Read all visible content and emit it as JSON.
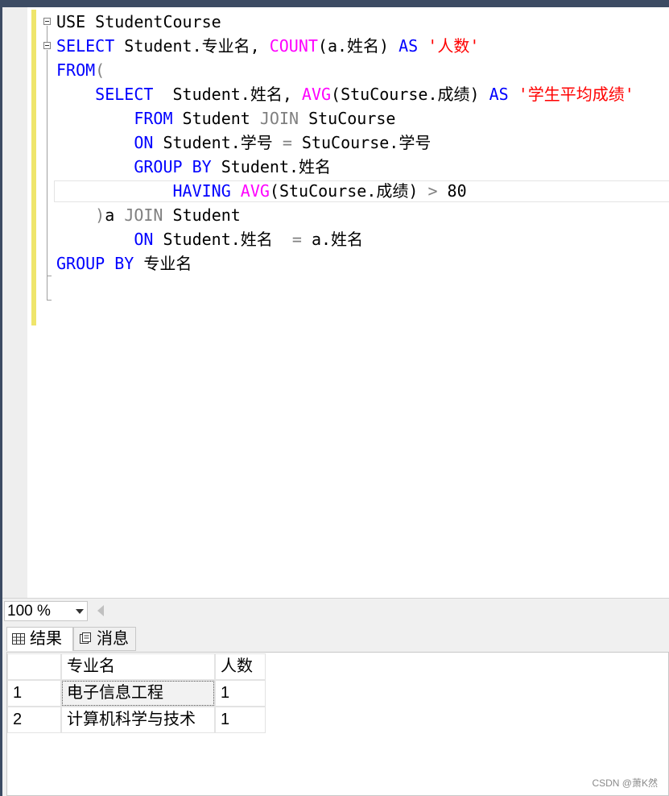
{
  "editor": {
    "lines": [
      [
        {
          "t": "USE StudentCourse",
          "c": ""
        }
      ],
      [
        {
          "t": "SELECT",
          "c": "kw"
        },
        {
          "t": " Student.专业名, ",
          "c": ""
        },
        {
          "t": "COUNT",
          "c": "fn"
        },
        {
          "t": "(a.姓名) ",
          "c": ""
        },
        {
          "t": "AS",
          "c": "kw"
        },
        {
          "t": " '人数'",
          "c": "str"
        }
      ],
      [
        {
          "t": "FROM",
          "c": "kw"
        },
        {
          "t": "(",
          "c": "gray"
        }
      ],
      [
        {
          "t": "    ",
          "c": ""
        },
        {
          "t": "SELECT",
          "c": "kw"
        },
        {
          "t": "  Student.姓名, ",
          "c": ""
        },
        {
          "t": "AVG",
          "c": "fn"
        },
        {
          "t": "(StuCourse.成绩) ",
          "c": ""
        },
        {
          "t": "AS",
          "c": "kw"
        },
        {
          "t": " '学生平均成绩'",
          "c": "str"
        }
      ],
      [
        {
          "t": "        ",
          "c": ""
        },
        {
          "t": "FROM",
          "c": "kw"
        },
        {
          "t": " Student ",
          "c": ""
        },
        {
          "t": "JOIN",
          "c": "gray"
        },
        {
          "t": " StuCourse",
          "c": ""
        }
      ],
      [
        {
          "t": "        ",
          "c": ""
        },
        {
          "t": "ON",
          "c": "kw"
        },
        {
          "t": " Student.学号 ",
          "c": ""
        },
        {
          "t": "=",
          "c": "gray"
        },
        {
          "t": " StuCourse.学号",
          "c": ""
        }
      ],
      [
        {
          "t": "        ",
          "c": ""
        },
        {
          "t": "GROUP BY",
          "c": "kw"
        },
        {
          "t": " Student.姓名",
          "c": ""
        }
      ],
      [
        {
          "t": "            ",
          "c": ""
        },
        {
          "t": "HAVING",
          "c": "kw"
        },
        {
          "t": " ",
          "c": ""
        },
        {
          "t": "AVG",
          "c": "fn"
        },
        {
          "t": "(StuCourse.成绩) ",
          "c": ""
        },
        {
          "t": ">",
          "c": "gray"
        },
        {
          "t": " 80",
          "c": ""
        }
      ],
      [
        {
          "t": "    ",
          "c": ""
        },
        {
          "t": ")",
          "c": "gray"
        },
        {
          "t": "a ",
          "c": ""
        },
        {
          "t": "JOIN",
          "c": "gray"
        },
        {
          "t": " Student",
          "c": ""
        }
      ],
      [
        {
          "t": "        ",
          "c": ""
        },
        {
          "t": "ON",
          "c": "kw"
        },
        {
          "t": " Student.姓名  ",
          "c": ""
        },
        {
          "t": "=",
          "c": "gray"
        },
        {
          "t": " a.姓名",
          "c": ""
        }
      ],
      [
        {
          "t": "GROUP BY",
          "c": "kw"
        },
        {
          "t": " 专业名",
          "c": ""
        }
      ]
    ]
  },
  "zoom": {
    "value": "100 %"
  },
  "tabs": {
    "results": "结果",
    "messages": "消息"
  },
  "grid": {
    "columns": [
      "专业名",
      "人数"
    ],
    "rows": [
      {
        "num": "1",
        "cells": [
          "电子信息工程",
          "1"
        ]
      },
      {
        "num": "2",
        "cells": [
          "计算机科学与技术",
          "1"
        ]
      }
    ]
  },
  "watermark": "CSDN @萧K然"
}
